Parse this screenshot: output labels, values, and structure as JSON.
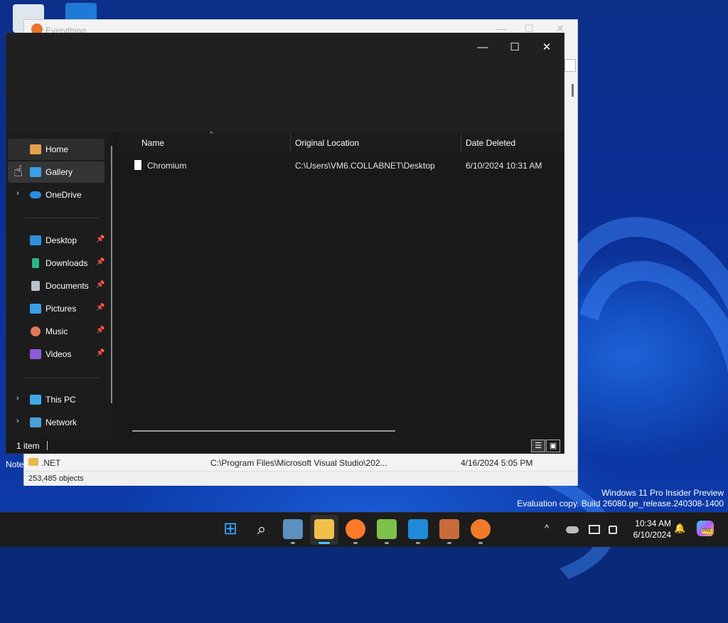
{
  "desktop": {
    "watermark_line1": "Windows 11 Pro Insider Preview",
    "watermark_line2": "Evaluation copy. Build 26080.ge_release.240308-1400",
    "partial_icon_label": "Note"
  },
  "background_window": {
    "title": "Everything",
    "row": {
      "name": ".NET",
      "path": "C:\\Program Files\\Microsoft Visual Studio\\202...",
      "date": "4/16/2024 5:05 PM"
    },
    "status": "253,485 objects"
  },
  "explorer": {
    "controls": {
      "minimize": "—",
      "maximize": "☐",
      "close": "✕"
    },
    "nav": {
      "home": "Home",
      "gallery": "Gallery",
      "onedrive": "OneDrive",
      "desktop": "Desktop",
      "downloads": "Downloads",
      "documents": "Documents",
      "pictures": "Pictures",
      "music": "Music",
      "videos": "Videos",
      "this_pc": "This PC",
      "network": "Network",
      "pin_glyph": "📌",
      "chevron": "›"
    },
    "columns": {
      "name": "Name",
      "original_location": "Original Location",
      "date_deleted": "Date Deleted",
      "sort_glyph": "^"
    },
    "rows": [
      {
        "name": "Chromium",
        "original_location": "C:\\Users\\VM6.COLLABNET\\Desktop",
        "date_deleted": "6/10/2024 10:31 AM"
      }
    ],
    "status": "1 item",
    "view_details": "☰",
    "view_tiles": "▣"
  },
  "taskbar": {
    "start_glyph": "⊞",
    "search_glyph": "⌕",
    "tray_chevron": "^",
    "time": "10:34 AM",
    "date": "6/10/2024",
    "bell_glyph": "🔔",
    "copilot_badge": "PRE"
  },
  "colors": {
    "explorer_bg": "#191919",
    "accent": "#4cc2ff",
    "taskbar_bg": "#1c1c1c"
  }
}
